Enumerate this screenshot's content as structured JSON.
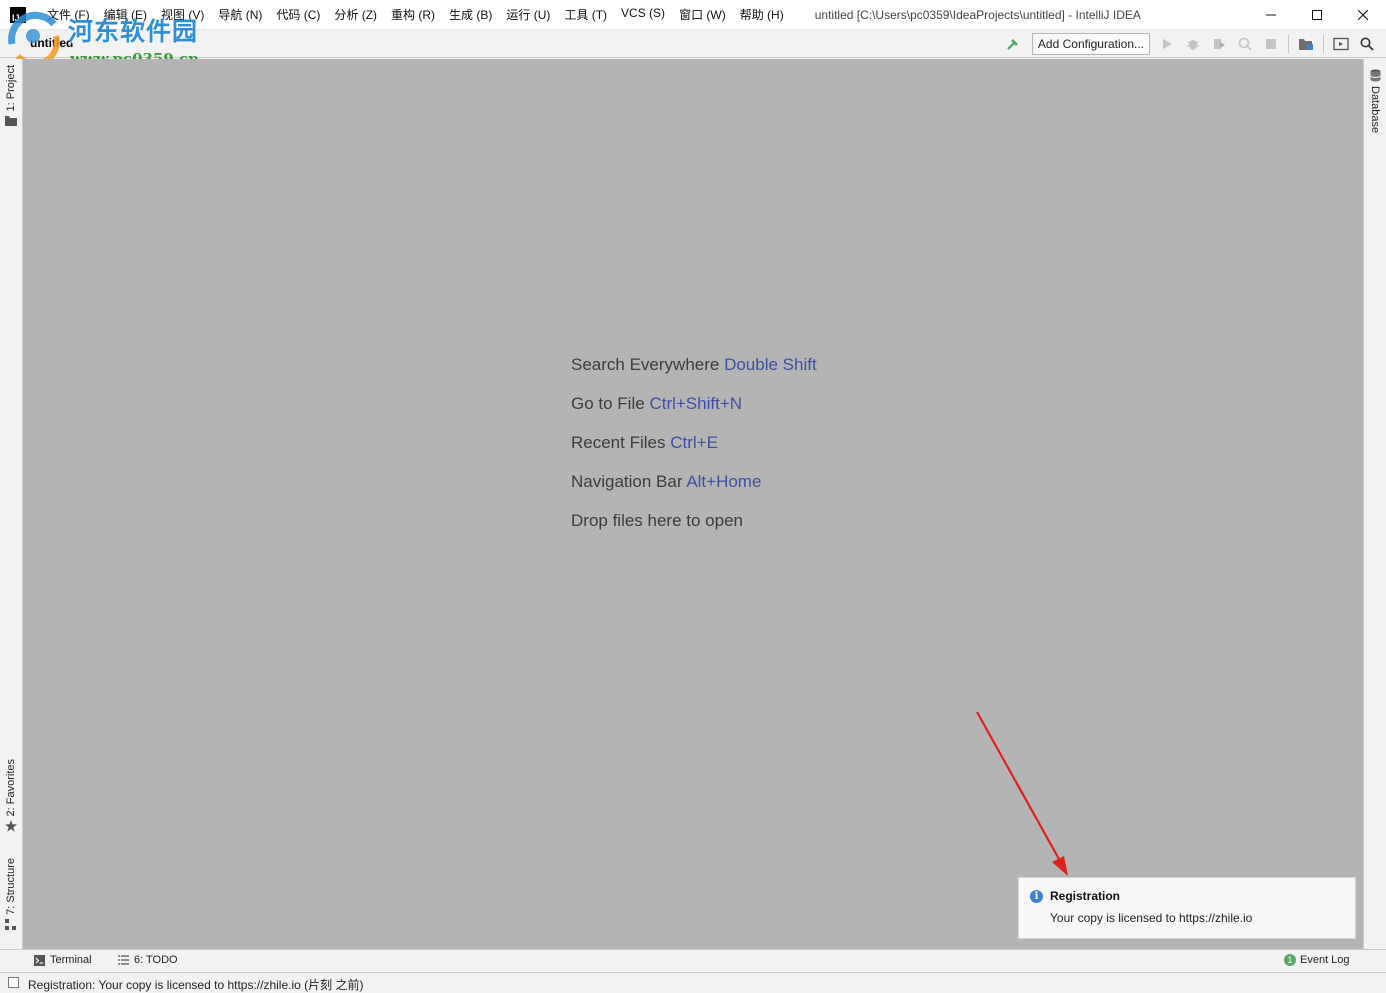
{
  "window": {
    "title": "untitled [C:\\Users\\pc0359\\IdeaProjects\\untitled] - IntelliJ IDEA",
    "app_icon_text": "IJ"
  },
  "menu": [
    "文件 (F)",
    "编辑 (E)",
    "视图 (V)",
    "导航 (N)",
    "代码 (C)",
    "分析 (Z)",
    "重构 (R)",
    "生成 (B)",
    "运行 (U)",
    "工具 (T)",
    "VCS (S)",
    "窗口 (W)",
    "帮助 (H)"
  ],
  "navbar": {
    "project": "untitled"
  },
  "watermark": {
    "cn": "河东软件园",
    "url": "www.pc0359.cn"
  },
  "toolbar": {
    "add_configuration": "Add Configuration...",
    "icons": [
      "build-hammer-icon",
      "run-icon",
      "debug-icon",
      "coverage-icon",
      "profile-icon",
      "stop-icon",
      "project-structure-icon",
      "presentation-icon",
      "search-icon"
    ]
  },
  "tool_windows": {
    "left_top": "1: Project",
    "left_favorites": "2: Favorites",
    "left_structure": "7: Structure",
    "right": "Database"
  },
  "editor_tips": [
    {
      "text": "Search Everywhere",
      "shortcut": "Double Shift"
    },
    {
      "text": "Go to File",
      "shortcut": "Ctrl+Shift+N"
    },
    {
      "text": "Recent Files",
      "shortcut": "Ctrl+E"
    },
    {
      "text": "Navigation Bar",
      "shortcut": "Alt+Home"
    },
    {
      "text": "Drop files here to open",
      "shortcut": ""
    }
  ],
  "notification": {
    "title": "Registration",
    "body": "Your copy is licensed to https://zhile.io"
  },
  "bottom_tabs": {
    "terminal": "Terminal",
    "todo": "6: TODO",
    "event_log": "Event Log",
    "event_log_count": "1"
  },
  "status": {
    "text": "Registration: Your copy is licensed to https://zhile.io (片刻 之前)"
  },
  "colors": {
    "editor_bg": "#b4b4b4",
    "shortcut": "#3d4fa3",
    "accent_blue": "#3f7fd1",
    "arrow_red": "#e0201b",
    "run_green": "#59a869"
  }
}
